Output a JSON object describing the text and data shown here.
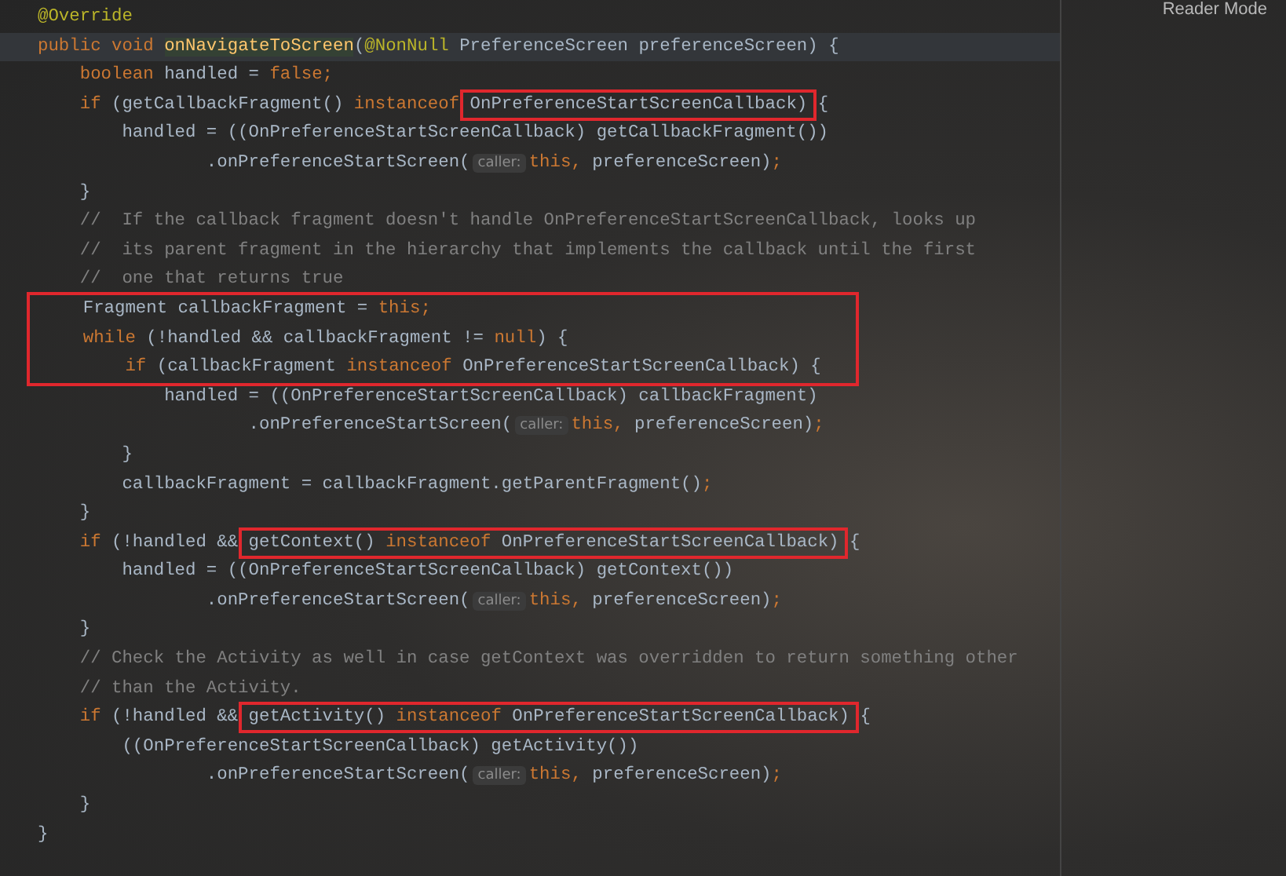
{
  "reader_mode": "Reader Mode",
  "code": [
    {
      "boxed": false,
      "lines": [
        {
          "current": false,
          "tokens": [
            {
              "kind": "annotation",
              "text": "@Override"
            }
          ]
        },
        {
          "current": true,
          "tokens": [
            {
              "kind": "keyword",
              "text": "public void "
            },
            {
              "kind": "method",
              "text": "onNavigateToScreen"
            },
            {
              "kind": "plain",
              "text": "("
            },
            {
              "kind": "annotation",
              "text": "@NonNull"
            },
            {
              "kind": "plain",
              "text": " PreferenceScreen preferenceScreen) {"
            }
          ]
        },
        {
          "current": false,
          "tokens": [
            {
              "kind": "keyword",
              "text": "    boolean "
            },
            {
              "kind": "plain",
              "text": "handled = "
            },
            {
              "kind": "keyword",
              "text": "false;"
            }
          ]
        },
        {
          "current": false,
          "tokens": [
            {
              "kind": "keyword",
              "text": "    if "
            },
            {
              "kind": "plain",
              "text": "(getCallbackFragment() "
            },
            {
              "kind": "keyword",
              "text": "instanceof "
            },
            {
              "kind": "box",
              "tokens": [
                {
                  "kind": "plain",
                  "text": "OnPreferenceStartScreenCallback)"
                }
              ]
            },
            {
              "kind": "plain",
              "text": " {"
            }
          ]
        },
        {
          "current": false,
          "tokens": [
            {
              "kind": "plain",
              "text": "        handled = ((OnPreferenceStartScreenCallback) getCallbackFragment())"
            }
          ]
        },
        {
          "current": false,
          "tokens": [
            {
              "kind": "plain",
              "text": "                .onPreferenceStartScreen("
            },
            {
              "kind": "hint",
              "text": "caller:"
            },
            {
              "kind": "keyword",
              "text": "this, "
            },
            {
              "kind": "plain",
              "text": "preferenceScreen)"
            },
            {
              "kind": "keyword",
              "text": ";"
            }
          ]
        },
        {
          "current": false,
          "tokens": [
            {
              "kind": "plain",
              "text": "    }"
            }
          ]
        },
        {
          "current": false,
          "tokens": [
            {
              "kind": "comment",
              "text": "    //  If the callback fragment doesn't handle OnPreferenceStartScreenCallback, looks up"
            }
          ]
        },
        {
          "current": false,
          "tokens": [
            {
              "kind": "comment",
              "text": "    //  its parent fragment in the hierarchy that implements the callback until the first"
            }
          ]
        },
        {
          "current": false,
          "tokens": [
            {
              "kind": "comment",
              "text": "    //  one that returns true"
            }
          ]
        }
      ]
    },
    {
      "boxed": true,
      "lines": [
        {
          "current": false,
          "tokens": [
            {
              "kind": "plain",
              "text": "    Fragment callbackFragment = "
            },
            {
              "kind": "keyword",
              "text": "this;"
            }
          ]
        },
        {
          "current": false,
          "tokens": [
            {
              "kind": "keyword",
              "text": "    while "
            },
            {
              "kind": "plain",
              "text": "(!handled && callbackFragment != "
            },
            {
              "kind": "keyword",
              "text": "null"
            },
            {
              "kind": "plain",
              "text": ") {"
            }
          ]
        },
        {
          "current": false,
          "tokens": [
            {
              "kind": "keyword",
              "text": "        if "
            },
            {
              "kind": "plain",
              "text": "(callbackFragment "
            },
            {
              "kind": "keyword",
              "text": "instanceof "
            },
            {
              "kind": "plain",
              "text": "OnPreferenceStartScreenCallback) {"
            }
          ]
        }
      ]
    },
    {
      "boxed": false,
      "lines": [
        {
          "current": false,
          "tokens": [
            {
              "kind": "plain",
              "text": "            handled = ((OnPreferenceStartScreenCallback) callbackFragment)"
            }
          ]
        },
        {
          "current": false,
          "tokens": [
            {
              "kind": "plain",
              "text": "                    .onPreferenceStartScreen("
            },
            {
              "kind": "hint",
              "text": "caller:"
            },
            {
              "kind": "keyword",
              "text": "this, "
            },
            {
              "kind": "plain",
              "text": "preferenceScreen)"
            },
            {
              "kind": "keyword",
              "text": ";"
            }
          ]
        },
        {
          "current": false,
          "tokens": [
            {
              "kind": "plain",
              "text": "        }"
            }
          ]
        },
        {
          "current": false,
          "tokens": [
            {
              "kind": "plain",
              "text": "        callbackFragment = callbackFragment.getParentFragment()"
            },
            {
              "kind": "keyword",
              "text": ";"
            }
          ]
        },
        {
          "current": false,
          "tokens": [
            {
              "kind": "plain",
              "text": "    }"
            }
          ]
        },
        {
          "current": false,
          "tokens": [
            {
              "kind": "keyword",
              "text": "    if "
            },
            {
              "kind": "plain",
              "text": "(!handled && "
            },
            {
              "kind": "box",
              "tokens": [
                {
                  "kind": "plain",
                  "text": "getContext() "
                },
                {
                  "kind": "keyword",
                  "text": "instanceof "
                },
                {
                  "kind": "plain",
                  "text": "OnPreferenceStartScreenCallback)"
                }
              ]
            },
            {
              "kind": "plain",
              "text": " {"
            }
          ]
        },
        {
          "current": false,
          "tokens": [
            {
              "kind": "plain",
              "text": "        handled = ((OnPreferenceStartScreenCallback) getContext())"
            }
          ]
        },
        {
          "current": false,
          "tokens": [
            {
              "kind": "plain",
              "text": "                .onPreferenceStartScreen("
            },
            {
              "kind": "hint",
              "text": "caller:"
            },
            {
              "kind": "keyword",
              "text": "this, "
            },
            {
              "kind": "plain",
              "text": "preferenceScreen)"
            },
            {
              "kind": "keyword",
              "text": ";"
            }
          ]
        },
        {
          "current": false,
          "tokens": [
            {
              "kind": "plain",
              "text": "    }"
            }
          ]
        },
        {
          "current": false,
          "tokens": [
            {
              "kind": "comment",
              "text": "    // Check the Activity as well in case getContext was overridden to return something other"
            }
          ]
        },
        {
          "current": false,
          "tokens": [
            {
              "kind": "comment",
              "text": "    // than the Activity."
            }
          ]
        },
        {
          "current": false,
          "tokens": [
            {
              "kind": "keyword",
              "text": "    if "
            },
            {
              "kind": "plain",
              "text": "(!handled && "
            },
            {
              "kind": "box",
              "tokens": [
                {
                  "kind": "plain",
                  "text": "getActivity() "
                },
                {
                  "kind": "keyword",
                  "text": "instanceof "
                },
                {
                  "kind": "plain",
                  "text": "OnPreferenceStartScreenCallback)"
                }
              ]
            },
            {
              "kind": "plain",
              "text": " {"
            }
          ]
        },
        {
          "current": false,
          "tokens": [
            {
              "kind": "plain",
              "text": "        ((OnPreferenceStartScreenCallback) getActivity())"
            }
          ]
        },
        {
          "current": false,
          "tokens": [
            {
              "kind": "plain",
              "text": "                .onPreferenceStartScreen("
            },
            {
              "kind": "hint",
              "text": "caller:"
            },
            {
              "kind": "keyword",
              "text": "this, "
            },
            {
              "kind": "plain",
              "text": "preferenceScreen)"
            },
            {
              "kind": "keyword",
              "text": ";"
            }
          ]
        },
        {
          "current": false,
          "tokens": [
            {
              "kind": "plain",
              "text": "    }"
            }
          ]
        },
        {
          "current": false,
          "tokens": [
            {
              "kind": "plain",
              "text": "}"
            }
          ]
        }
      ]
    }
  ]
}
